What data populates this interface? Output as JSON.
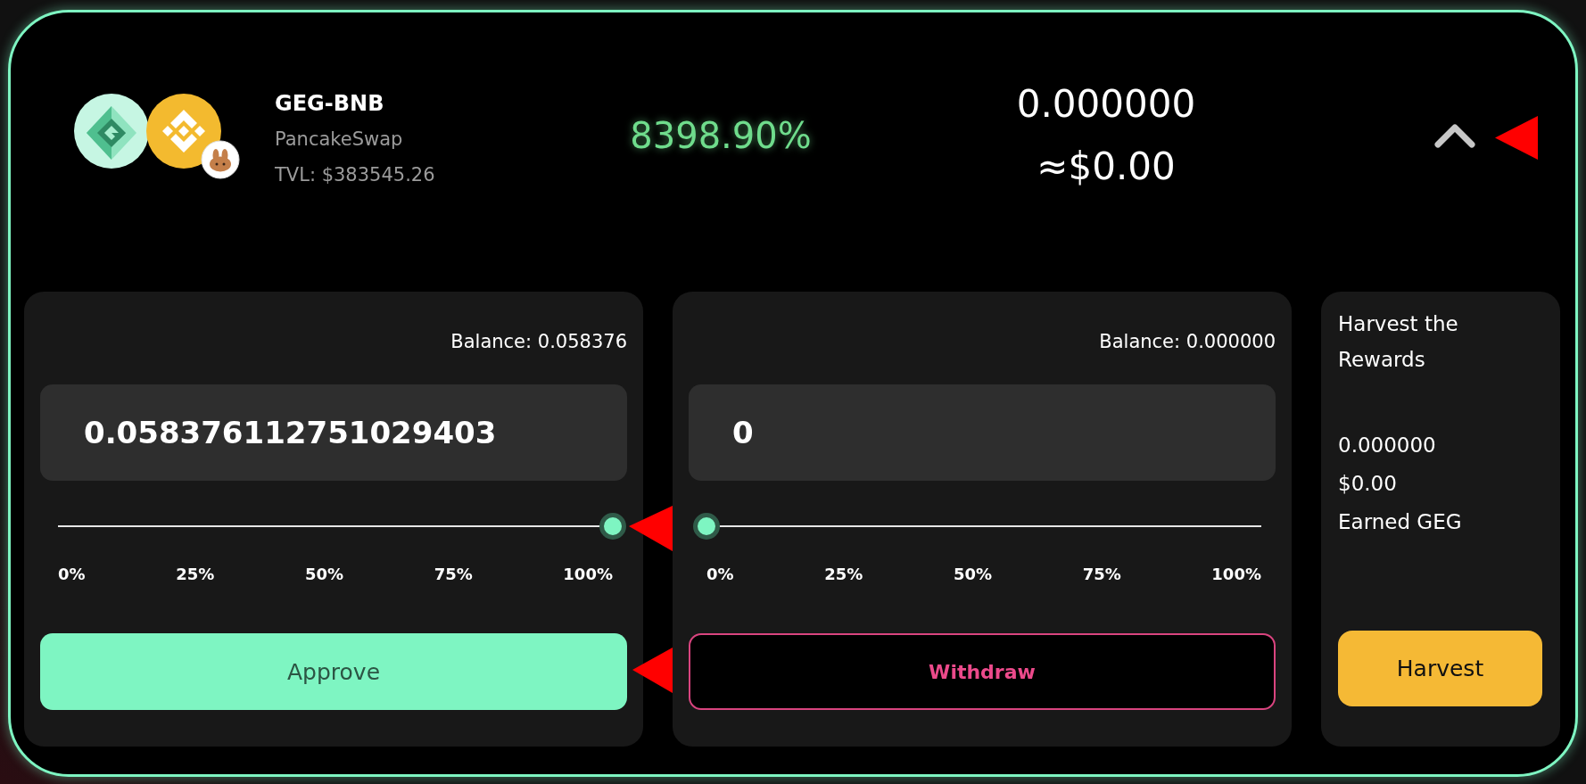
{
  "pool": {
    "pair": "GEG-BNB",
    "exchange": "PancakeSwap",
    "tvl": "TVL: $383545.26",
    "apr": "8398.90%",
    "staked_amount": "0.000000",
    "staked_value": "≈$0.00",
    "expanded": true
  },
  "panels": [
    {
      "kind": "deposit",
      "balance": "Balance: 0.058376",
      "value": "0.058376112751029403",
      "slider": {
        "level": 1
      },
      "ticks": [
        "0%",
        "25%",
        "50%",
        "75%",
        "100%"
      ],
      "button": "Approve"
    },
    {
      "kind": "withdraw",
      "balance": "Balance: 0.000000",
      "value": "0",
      "slider": {
        "level": 0
      },
      "ticks": [
        "0%",
        "25%",
        "50%",
        "75%",
        "100%"
      ],
      "button": "Withdraw"
    }
  ],
  "harvest": {
    "title": "Harvest the Rewards",
    "amount": "0.000000",
    "value": "$0.00",
    "label": "Earned GEG",
    "button": "Harvest"
  }
}
